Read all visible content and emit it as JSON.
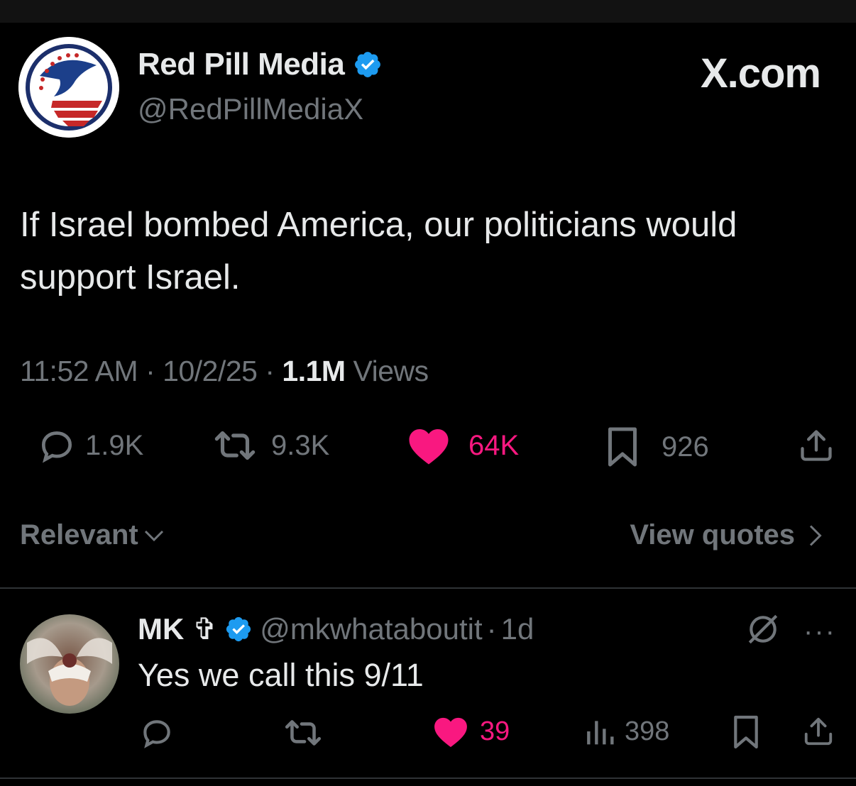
{
  "post": {
    "author_name": "Red Pill Media",
    "author_handle": "@RedPillMediaX",
    "watermark": "X.com",
    "text": "If Israel bombed America, our politicians would support Israel.",
    "time": "11:52 AM",
    "date": "10/2/25",
    "separator": "·",
    "views_count": "1.1M",
    "views_label": "Views",
    "actions": {
      "replies": "1.9K",
      "reposts": "9.3K",
      "likes": "64K",
      "bookmarks": "926"
    }
  },
  "filters": {
    "sort_label": "Relevant",
    "view_quotes_label": "View quotes"
  },
  "reply": {
    "name": "MK ✞",
    "handle": "@mkwhataboutit",
    "age": "1d",
    "separator": "·",
    "text": "Yes we call this 9/11",
    "more": "···",
    "actions": {
      "likes": "39",
      "views": "398"
    }
  },
  "colors": {
    "background": "#000000",
    "text": "#e7e9ea",
    "muted": "#71767b",
    "like_pink": "#f91880",
    "verified_blue": "#1d9bf0"
  },
  "icons": [
    "reply-icon",
    "repost-icon",
    "heart-icon",
    "bookmark-icon",
    "share-icon",
    "chevron-down-icon",
    "chevron-right-icon",
    "grok-icon",
    "analytics-icon",
    "verified-icon"
  ]
}
